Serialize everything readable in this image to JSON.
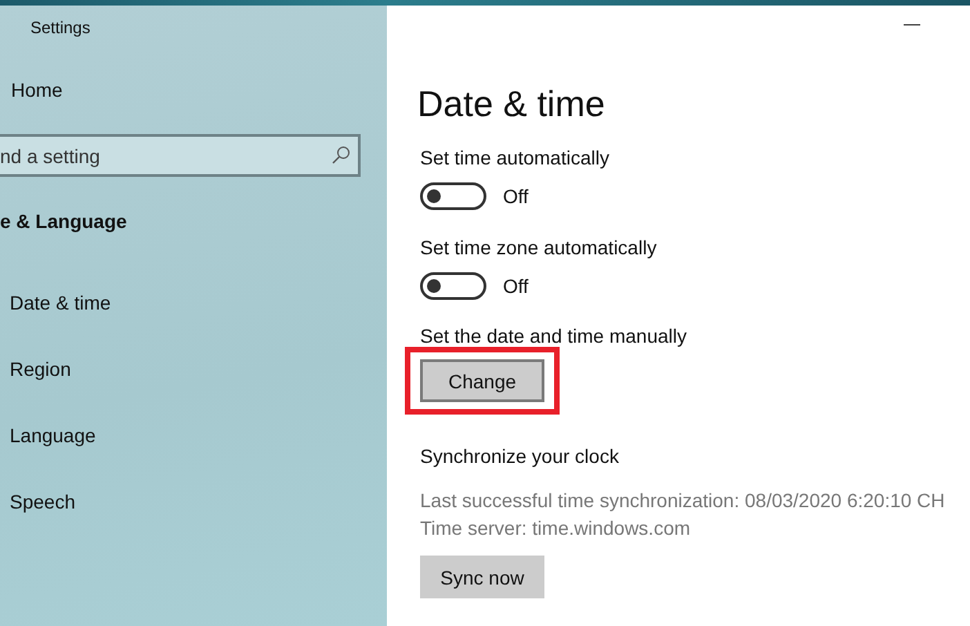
{
  "window": {
    "title": "Settings",
    "minimize": "—"
  },
  "sidebar": {
    "home": "Home",
    "search": {
      "placeholder": "nd a setting"
    },
    "section": "e & Language",
    "items": [
      {
        "label": "Date & time"
      },
      {
        "label": "Region"
      },
      {
        "label": "Language"
      },
      {
        "label": "Speech"
      }
    ]
  },
  "content": {
    "title": "Date & time",
    "toggles": [
      {
        "label": "Set time automatically",
        "on": false,
        "state": "Off"
      },
      {
        "label": "Set time zone automatically",
        "on": false,
        "state": "Off"
      }
    ],
    "manual": {
      "label": "Set the date and time manually",
      "button": "Change",
      "highlighted": true
    },
    "sync": {
      "heading": "Synchronize your clock",
      "last": "Last successful time synchronization: 08/03/2020 6:20:10 CH",
      "server": "Time server: time.windows.com",
      "button": "Sync now"
    }
  }
}
